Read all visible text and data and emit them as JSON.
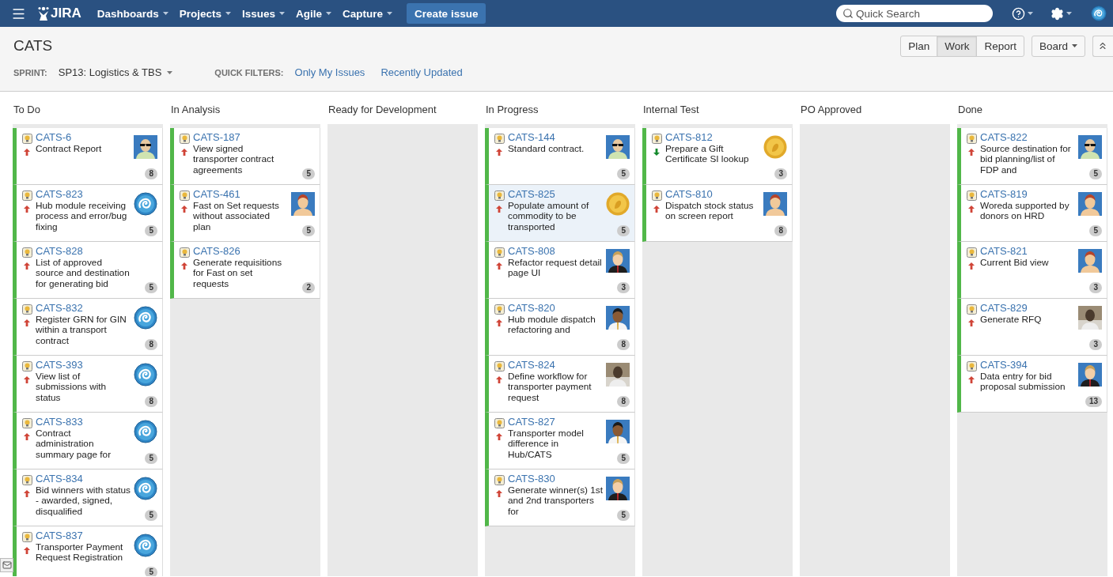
{
  "header": {
    "logo": "JIRA",
    "nav": [
      {
        "label": "Dashboards"
      },
      {
        "label": "Projects"
      },
      {
        "label": "Issues"
      },
      {
        "label": "Agile"
      },
      {
        "label": "Capture"
      }
    ],
    "create_button": "Create issue",
    "search": {
      "placeholder": "Quick Search"
    }
  },
  "board": {
    "title": "CATS",
    "views": [
      {
        "label": "Plan",
        "selected": false
      },
      {
        "label": "Work",
        "selected": true
      },
      {
        "label": "Report",
        "selected": false
      }
    ],
    "board_menu": "Board",
    "sprint_label": "SPRINT:",
    "sprint": "SP13: Logistics & TBS",
    "quick_filters_label": "QUICK FILTERS:",
    "quick_filters": [
      "Only My Issues",
      "Recently Updated"
    ]
  },
  "columns": [
    {
      "name": "To Do",
      "cards": [
        {
          "key": "CATS-6",
          "summary": "Contract Report",
          "priority_arrow": {
            "kind": "up"
          },
          "avatar": {
            "kind": "glasses"
          },
          "estimate": "8",
          "selected": false
        },
        {
          "key": "CATS-823",
          "summary": "Hub module receiving process and error/bug fixing",
          "priority_arrow": {
            "kind": "up"
          },
          "avatar": {
            "kind": "spiral"
          },
          "estimate": "5",
          "selected": false
        },
        {
          "key": "CATS-828",
          "summary": "List of approved source and destination for generating bid",
          "priority_arrow": {
            "kind": "up"
          },
          "estimate": "5",
          "selected": false
        },
        {
          "key": "CATS-832",
          "summary": "Register GRN for GIN within a transport contract",
          "priority_arrow": {
            "kind": "up"
          },
          "avatar": {
            "kind": "spiral"
          },
          "estimate": "8",
          "selected": false
        },
        {
          "key": "CATS-393",
          "summary": "View list of submissions with status",
          "priority_arrow": {
            "kind": "up"
          },
          "avatar": {
            "kind": "spiral"
          },
          "estimate": "8",
          "selected": false
        },
        {
          "key": "CATS-833",
          "summary": "Contract administration summary page for",
          "priority_arrow": {
            "kind": "up"
          },
          "avatar": {
            "kind": "spiral"
          },
          "estimate": "5",
          "selected": false
        },
        {
          "key": "CATS-834",
          "summary": "Bid winners with status - awarded, signed, disqualified",
          "priority_arrow": {
            "kind": "up"
          },
          "avatar": {
            "kind": "spiral"
          },
          "estimate": "5",
          "selected": false
        },
        {
          "key": "CATS-837",
          "summary": "Transporter Payment Request Registration",
          "priority_arrow": {
            "kind": "up"
          },
          "avatar": {
            "kind": "spiral"
          },
          "estimate": "5",
          "selected": false
        }
      ]
    },
    {
      "name": "In Analysis",
      "cards": [
        {
          "key": "CATS-187",
          "summary": "View signed transporter contract agreements",
          "priority_arrow": {
            "kind": "up"
          },
          "estimate": "5",
          "selected": false
        },
        {
          "key": "CATS-461",
          "summary": "Fast on Set requests without associated plan",
          "priority_arrow": {
            "kind": "up"
          },
          "avatar": {
            "kind": "redhair"
          },
          "estimate": "5",
          "selected": false
        },
        {
          "key": "CATS-826",
          "summary": "Generate requisitions for Fast on set requests",
          "priority_arrow": {
            "kind": "up"
          },
          "estimate": "2",
          "selected": false
        }
      ]
    },
    {
      "name": "Ready for Development"
    },
    {
      "name": "In Progress",
      "cards": [
        {
          "key": "CATS-144",
          "summary": "Standard contract.",
          "priority_arrow": {
            "kind": "up"
          },
          "avatar": {
            "kind": "glasses"
          },
          "estimate": "5",
          "selected": false
        },
        {
          "key": "CATS-825",
          "summary": "Populate amount of commodity to be transported",
          "priority_arrow": {
            "kind": "up"
          },
          "avatar": {
            "kind": "coin"
          },
          "estimate": "5",
          "selected": true
        },
        {
          "key": "CATS-808",
          "summary": "Refactor request detail page UI",
          "priority_arrow": {
            "kind": "up"
          },
          "avatar": {
            "kind": "suit"
          },
          "estimate": "3",
          "selected": false
        },
        {
          "key": "CATS-820",
          "summary": "Hub module dispatch refactoring and",
          "priority_arrow": {
            "kind": "up"
          },
          "avatar": {
            "kind": "dark"
          },
          "estimate": "8",
          "selected": false
        },
        {
          "key": "CATS-824",
          "summary": "Define workflow for transporter payment request",
          "priority_arrow": {
            "kind": "up"
          },
          "avatar": {
            "kind": "photo"
          },
          "estimate": "8",
          "selected": false
        },
        {
          "key": "CATS-827",
          "summary": "Transporter model difference in Hub/CATS",
          "priority_arrow": {
            "kind": "up"
          },
          "avatar": {
            "kind": "dark"
          },
          "estimate": "5",
          "selected": false
        },
        {
          "key": "CATS-830",
          "summary": "Generate winner(s) 1st and 2nd transporters for",
          "priority_arrow": {
            "kind": "up"
          },
          "avatar": {
            "kind": "suit"
          },
          "estimate": "5",
          "selected": false
        }
      ]
    },
    {
      "name": "Internal Test",
      "cards": [
        {
          "key": "CATS-812",
          "summary": "Prepare a Gift Certificate SI lookup",
          "priority_arrow": {
            "kind": "down"
          },
          "avatar": {
            "kind": "coin"
          },
          "estimate": "3",
          "selected": false
        },
        {
          "key": "CATS-810",
          "summary": "Dispatch stock status on screen report",
          "priority_arrow": {
            "kind": "up"
          },
          "avatar": {
            "kind": "redhair"
          },
          "estimate": "8",
          "selected": false
        }
      ]
    },
    {
      "name": "PO Approved"
    },
    {
      "name": "Done",
      "cards": [
        {
          "key": "CATS-822",
          "summary": "Source destination for bid planning/list of FDP and",
          "priority_arrow": {
            "kind": "up"
          },
          "avatar": {
            "kind": "glasses"
          },
          "estimate": "5",
          "selected": false
        },
        {
          "key": "CATS-819",
          "summary": "Woreda supported by donors on HRD",
          "priority_arrow": {
            "kind": "up"
          },
          "avatar": {
            "kind": "redhair"
          },
          "estimate": "5",
          "selected": false
        },
        {
          "key": "CATS-821",
          "summary": "Current Bid view",
          "priority_arrow": {
            "kind": "up"
          },
          "avatar": {
            "kind": "redhair"
          },
          "estimate": "3",
          "selected": false
        },
        {
          "key": "CATS-829",
          "summary": "Generate RFQ",
          "priority_arrow": {
            "kind": "up"
          },
          "avatar": {
            "kind": "photo"
          },
          "estimate": "3",
          "selected": false
        },
        {
          "key": "CATS-394",
          "summary": "Data entry for bid proposal submission",
          "priority_arrow": {
            "kind": "up"
          },
          "avatar": {
            "kind": "suit"
          },
          "estimate": "13",
          "selected": false
        }
      ]
    }
  ]
}
